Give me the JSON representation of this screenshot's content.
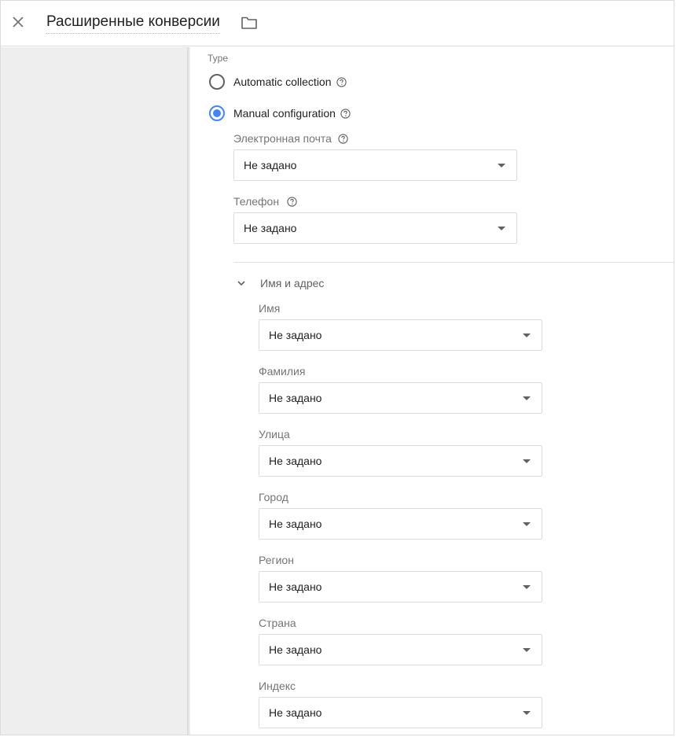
{
  "header": {
    "title": "Расширенные конверсии"
  },
  "form": {
    "type_label": "Type",
    "radios": [
      {
        "label": "Automatic collection",
        "checked": false
      },
      {
        "label": "Manual configuration",
        "checked": true
      }
    ],
    "email": {
      "label": "Электронная почта",
      "value": "Не задано"
    },
    "phone": {
      "label": "Телефон",
      "value": "Не задано"
    },
    "section": {
      "title": "Имя и адрес",
      "fields": [
        {
          "label": "Имя",
          "value": "Не задано"
        },
        {
          "label": "Фамилия",
          "value": "Не задано"
        },
        {
          "label": "Улица",
          "value": "Не задано"
        },
        {
          "label": "Город",
          "value": "Не задано"
        },
        {
          "label": "Регион",
          "value": "Не задано"
        },
        {
          "label": "Страна",
          "value": "Не задано"
        },
        {
          "label": "Индекс",
          "value": "Не задано"
        }
      ]
    }
  },
  "colors": {
    "accent": "#4285f4",
    "left_pane": "#eeeeee",
    "border": "#dadce0"
  },
  "icons": [
    "close-icon",
    "folder-icon",
    "help-icon",
    "chevron-down-icon",
    "dropdown-arrow-icon"
  ]
}
